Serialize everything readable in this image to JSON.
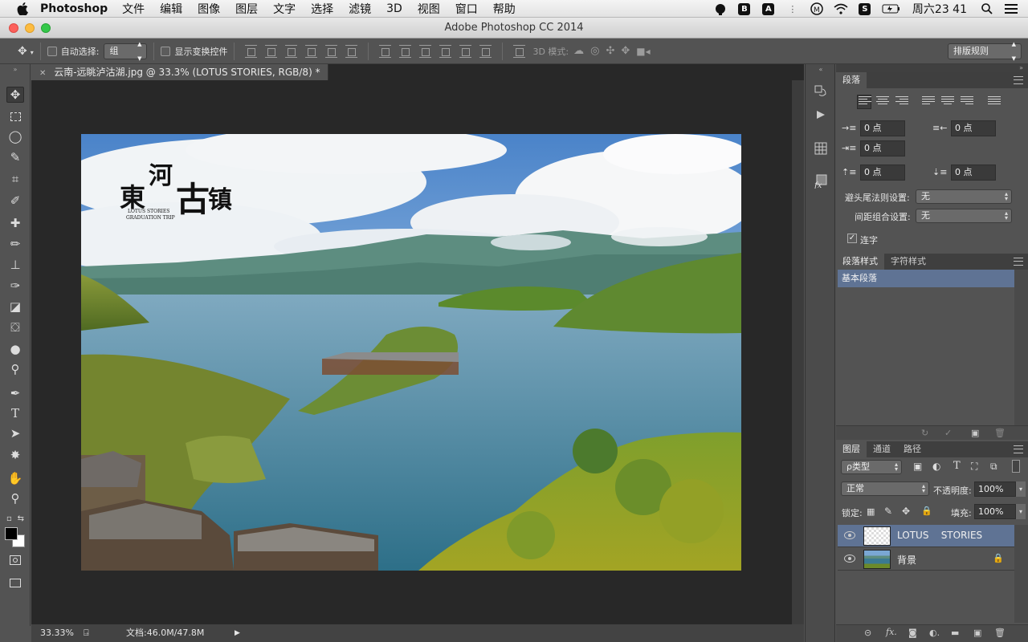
{
  "menubar": {
    "app": "Photoshop",
    "items": [
      "文件",
      "编辑",
      "图像",
      "图层",
      "文字",
      "选择",
      "滤镜",
      "3D",
      "视图",
      "窗口",
      "帮助"
    ],
    "clock": "周六23 41",
    "status_icons": [
      "notification-icon",
      "bbedit-icon",
      "adobe-icon",
      "more-icon",
      "m-icon",
      "wifi-icon",
      "s-icon",
      "battery-icon",
      "search-icon",
      "list-icon"
    ]
  },
  "window": {
    "title": "Adobe Photoshop CC 2014"
  },
  "options": {
    "auto_select_label": "自动选择:",
    "auto_select_value": "组",
    "show_transform_label": "显示变换控件",
    "mode_3d_label": "3D 模式:",
    "workspace_value": "排版规则"
  },
  "document": {
    "tab_title": "云南-远眺泸沽湖.jpg @ 33.3% (LOTUS    STORIES, RGB/8) *",
    "logo_chars": [
      "東",
      "河",
      "古",
      "镇"
    ],
    "logo_sub1": "LOTUS    STORIES",
    "logo_sub2": "GRADUATION    TRIP"
  },
  "status": {
    "zoom": "33.33%",
    "doc_size": "文档:46.0M/47.8M"
  },
  "paragraph_panel": {
    "tab": "段落",
    "indent_left": "0 点",
    "indent_right": "0 点",
    "indent_first": "0 点",
    "space_before": "0 点",
    "space_after": "0 点",
    "kinsoku_label": "避头尾法则设置:",
    "kinsoku_value": "无",
    "mojikumi_label": "间距组合设置:",
    "mojikumi_value": "无",
    "hyphenate_label": "连字"
  },
  "styles_panel": {
    "tabs": [
      "段落样式",
      "字符样式"
    ],
    "items": [
      "基本段落"
    ]
  },
  "layers_panel": {
    "tabs": [
      "图层",
      "通道",
      "路径"
    ],
    "filter_value": "ρ类型",
    "blend_value": "正常",
    "opacity_label": "不透明度:",
    "opacity_value": "100%",
    "lock_label": "锁定:",
    "fill_label": "填充:",
    "fill_value": "100%",
    "layers": [
      {
        "name": "LOTUS    STORIES",
        "selected": true
      },
      {
        "name": "背景",
        "selected": false
      }
    ]
  },
  "colors": {
    "accent_selected": "#5f7394",
    "panel_bg": "#535353",
    "canvas_bg": "#282828"
  }
}
